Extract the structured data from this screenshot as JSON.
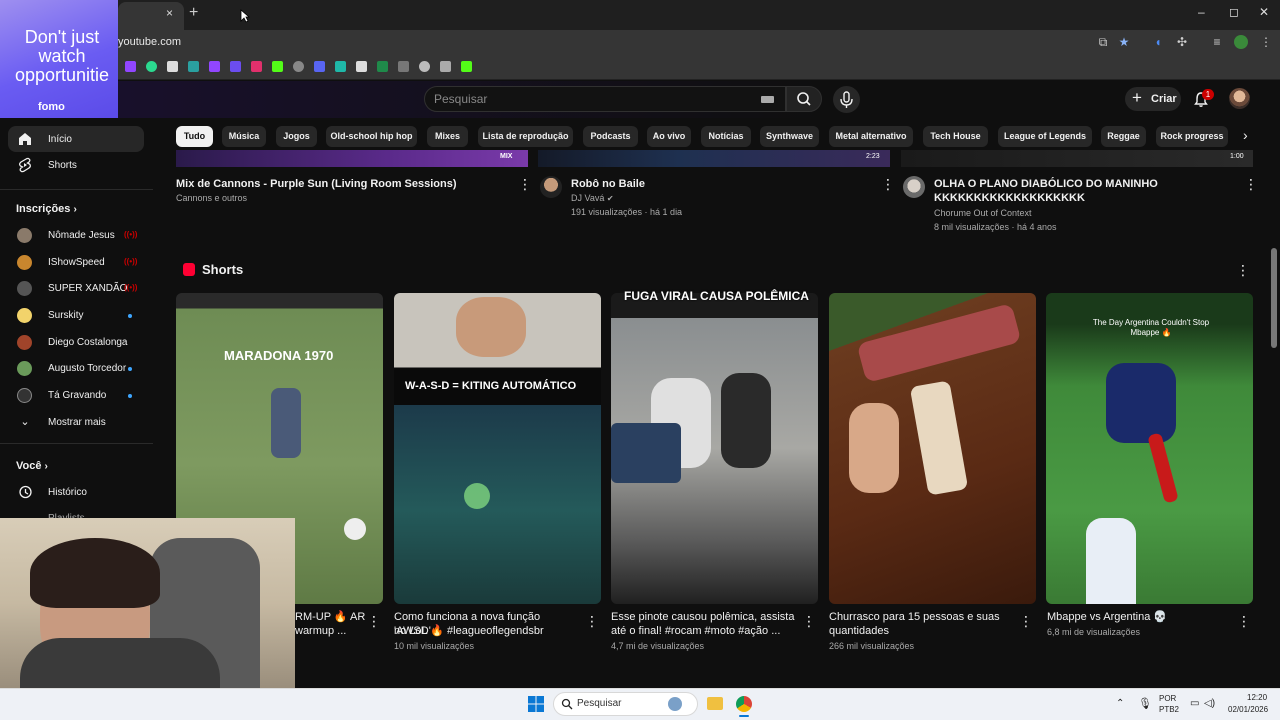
{
  "browser": {
    "url": "youtube.com",
    "tab_close": "×",
    "new_tab": "+",
    "window_controls": {
      "minimize": "–",
      "maximize": "◻",
      "close": "✕"
    }
  },
  "overlay_ad": {
    "text": "Don't just watch opportunitie",
    "logo": "fomo"
  },
  "header": {
    "search_placeholder": "Pesquisar",
    "create_label": "Criar",
    "notification_count": "1"
  },
  "sidebar": {
    "main": [
      {
        "label": "Início",
        "icon": "home-icon"
      },
      {
        "label": "Shorts",
        "icon": "shorts-icon"
      }
    ],
    "subscriptions_title": "Inscrições",
    "subscriptions": [
      {
        "label": "Nômade Jesus",
        "status": "live"
      },
      {
        "label": "IShowSpeed",
        "status": "live"
      },
      {
        "label": "SUPER XANDÃO",
        "status": "live"
      },
      {
        "label": "Surskity",
        "status": "new"
      },
      {
        "label": "Diego Costalonga",
        "status": ""
      },
      {
        "label": "Augusto Torcedor",
        "status": "new"
      },
      {
        "label": "Tá Gravando",
        "status": "new"
      }
    ],
    "show_more": "Mostrar mais",
    "you_title": "Você",
    "you_items": [
      {
        "label": "Histórico",
        "icon": "history-icon"
      },
      {
        "label": "Playlists",
        "icon": "playlist-icon"
      }
    ]
  },
  "chips": [
    "Tudo",
    "Música",
    "Jogos",
    "Old-school hip hop",
    "Mixes",
    "Lista de reprodução",
    "Podcasts",
    "Ao vivo",
    "Notícias",
    "Synthwave",
    "Metal alternativo",
    "Tech House",
    "League of Legends",
    "Reggae",
    "Rock progress"
  ],
  "videos": [
    {
      "title": "Mix de Cannons - Purple Sun (Living Room Sessions)",
      "channel": "Cannons e outros",
      "meta": "",
      "badge": "MIX"
    },
    {
      "title": "Robô no Baile",
      "channel": "DJ Vavá",
      "meta": "191 visualizações · há 1 dia",
      "badge": "2:23"
    },
    {
      "title": "OLHA O PLANO DIABÓLICO DO MANINHO KKKKKKKKKKKKKKKKKKK",
      "channel": "Chorume Out of Context",
      "meta": "8 mil visualizações · há 4 anos",
      "badge": "1:00"
    }
  ],
  "shorts_section": {
    "title": "Shorts",
    "items": [
      {
        "overlay": "MARADONA 1970",
        "title_line1": "RM-UP 🔥 AR",
        "title_line2": "warmup ...",
        "views": ""
      },
      {
        "overlay": "W-A-S-D = KITING AUTOMÁTICO",
        "title_line1": "Como funciona a nova função 'AWSD'",
        "title_line2": "no LoL 🔥 #leagueoflegendsbr",
        "views": "10 mil visualizações"
      },
      {
        "overlay": "FUGA VIRAL CAUSA POLÊMICA",
        "title_line1": "Esse pinote causou polêmica, assista",
        "title_line2": "até o final! #rocam #moto #ação ...",
        "views": "4,7 mi de visualizações"
      },
      {
        "overlay": "",
        "title_line1": "Churrasco para 15 pessoas e suas",
        "title_line2": "quantidades",
        "views": "266 mil visualizações"
      },
      {
        "overlay": "The Day Argentina Couldn't Stop Mbappe 🔥",
        "title_line1": "Mbappe vs Argentina 💀",
        "title_line2": "",
        "views": "6,8 mi de visualizações"
      }
    ]
  },
  "taskbar": {
    "search_label": "Pesquisar",
    "lang_top": "POR",
    "lang_bottom": "PTB2",
    "time": "12:20",
    "date": "02/01/2026"
  },
  "colors": {
    "background": "#0f0f0f",
    "accent_red": "#ff0033",
    "live_red": "#cc0000",
    "new_dot": "#3ea6ff",
    "ad_purple": "#6a5cf2"
  }
}
